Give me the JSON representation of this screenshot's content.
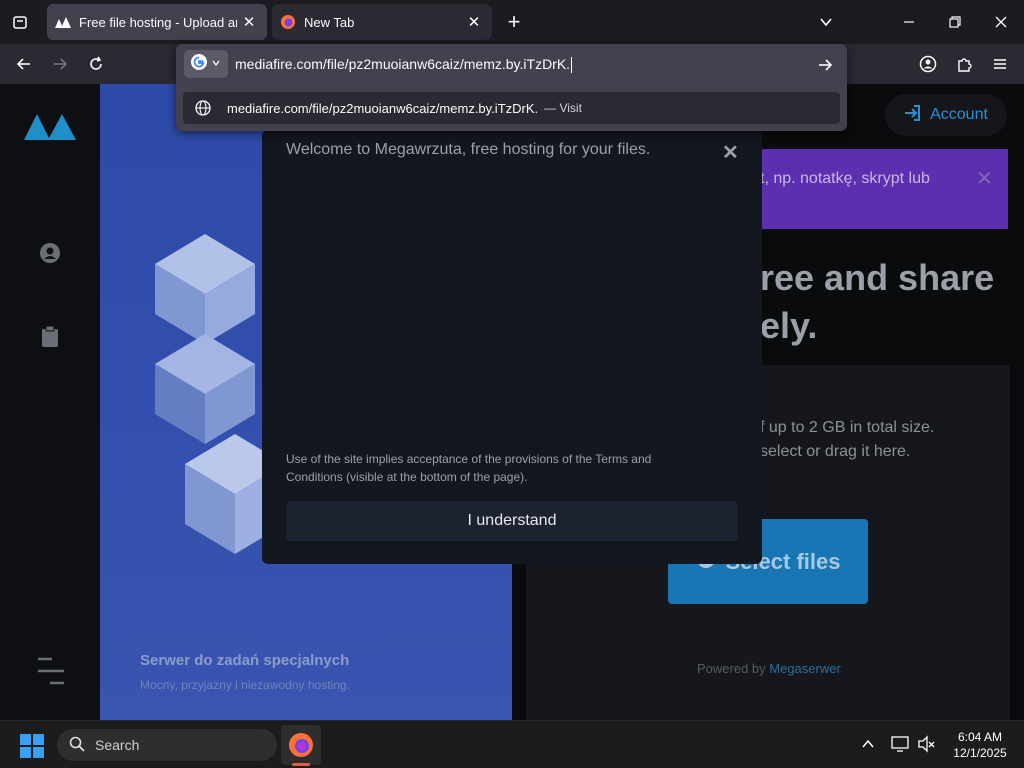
{
  "browser": {
    "tabs": [
      {
        "title": "Free file hosting - Upload and s",
        "active": true
      },
      {
        "title": "New Tab",
        "active": false
      }
    ],
    "url_text": "mediafire.com/file/pz2muoianw6caiz/memz.by.iTzDrK.",
    "suggestion": {
      "text": "mediafire.com/file/pz2muoianw6caiz/memz.by.iTzDrK.",
      "action": "— Visit"
    }
  },
  "page": {
    "account_label": "Account",
    "banner_text": "t, np. notatkę, skrypt lub",
    "banner_close": "✕",
    "headline": [
      "ree and share",
      "ely."
    ],
    "upload_text": [
      "f up to 2 GB in total size.",
      "select or drag it here."
    ],
    "select_files_label": "Select files",
    "powered_prefix": "Powered by ",
    "powered_link": "Megaserwer",
    "panel_title": "Serwer do zadań specjalnych",
    "panel_subtitle": "Mocny, przyjazny i niezawodny hosting."
  },
  "modal": {
    "title": "Welcome to Megawrzuta, free hosting for your files.",
    "close": "✕",
    "terms": "Use of the site implies acceptance of the provisions of the Terms and Conditions (visible at the bottom of the page).",
    "button": "I understand"
  },
  "taskbar": {
    "search_label": "Search",
    "time": "6:04 AM",
    "date": "12/1/2025"
  },
  "colors": {
    "accent_blue": "#1876b4",
    "panel_blue": "#3450ae",
    "banner_purple": "#5b2fae"
  }
}
